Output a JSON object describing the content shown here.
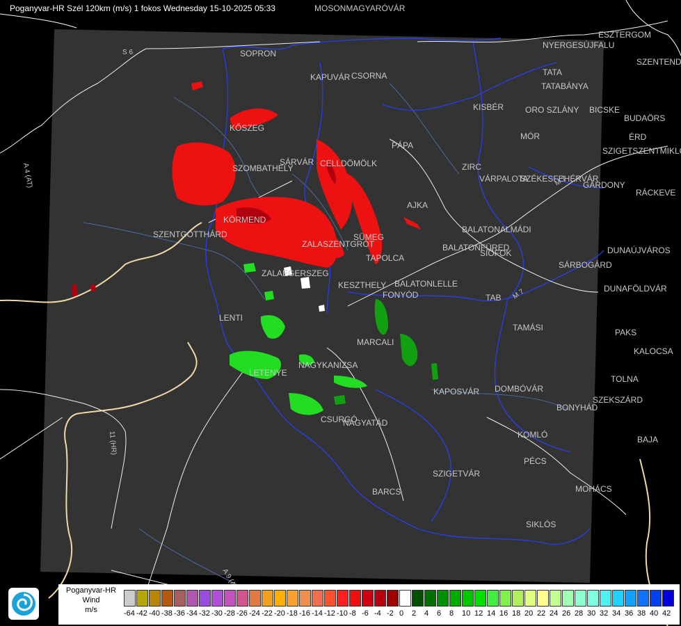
{
  "title": "Poganyvar-HR Szél 120km (m/s) 1 fokos Wednesday 15-10-2025 05:33",
  "cities": [
    "MOSONMAGYARÓVÁR",
    "SOPRON",
    "KAPUVÁR",
    "CSORNA",
    "KISBÉR",
    "TATA",
    "TATABÁNYA",
    "ESZTERGOM",
    "NYERGESÚJFALU",
    "SZENTENDRE",
    "ORO SZLÁNY",
    "BICSKE",
    "BUDAÖRS",
    "MÓR",
    "ÉRD",
    "SZIGETSZENTMIKLÓS",
    "KŐSZEG",
    "PÁPA",
    "SÁRVÁR",
    "CELLDÖMÖLK",
    "SZOMBATHELY",
    "ZIRC",
    "VÁRPALOTA",
    "SZÉKESFEHÉRVÁR",
    "GÁRDONY",
    "RÁCKEVE",
    "AJKA",
    "KÖRMEND",
    "SZENTGOTTHÁRD",
    "SÜMEG",
    "BALATONALMÁDI",
    "ZALASZENTGRÓT",
    "BALATONFÜRED",
    "SIÓFOK",
    "TAPOLCA",
    "DUNAÚJVÁROS",
    "SÁRBOGÁRD",
    "ZALAEGERSZEG",
    "KESZTHELY",
    "BALATONLELLE",
    "FONYÓD",
    "DUNAFÖLDVÁR",
    "TAB",
    "LENTI",
    "TAMÁSI",
    "PAKS",
    "MARCALI",
    "KALOCSA",
    "NAGYKANIZSA",
    "LETENYE",
    "TOLNA",
    "KAPOSVÁR",
    "DOMBÓVÁR",
    "SZEKSZÁRD",
    "BONYHÁD",
    "CSURGÓ",
    "NAGYATÁD",
    "KOMLÓ",
    "BAJA",
    "PÉCS",
    "SZIGETVÁR",
    "MOHÁCS",
    "BARCS",
    "SIKLÓS"
  ],
  "road_labels": [
    "S 6",
    "A 4 (AT)",
    "M 7",
    "M 7",
    "11 (HR)",
    "A 9 (AT)"
  ],
  "legend": {
    "label_lines": [
      "Poganyvar-HR",
      "Wind",
      "m/s"
    ],
    "ticks": [
      "-64",
      "-42",
      "-40",
      "-38",
      "-36",
      "-34",
      "-32",
      "-30",
      "-28",
      "-26",
      "-24",
      "-22",
      "-20",
      "-18",
      "-16",
      "-14",
      "-12",
      "-10",
      "-8",
      "-6",
      "-4",
      "-2",
      "0",
      "2",
      "4",
      "6",
      "8",
      "10",
      "12",
      "14",
      "16",
      "18",
      "20",
      "22",
      "24",
      "26",
      "28",
      "30",
      "32",
      "34",
      "36",
      "38",
      "40",
      "42"
    ],
    "colors": [
      "#cccccc",
      "#b5a60a",
      "#b88505",
      "#b45a10",
      "#a85f5f",
      "#b057b0",
      "#9a4ddd",
      "#b050d8",
      "#c053c0",
      "#d0558a",
      "#e07a40",
      "#f0a020",
      "#ffb000",
      "#f8a030",
      "#f09050",
      "#f07050",
      "#ff5030",
      "#ff2020",
      "#ee1010",
      "#d00010",
      "#b80010",
      "#a00000",
      "#ffffff",
      "#005000",
      "#007000",
      "#009000",
      "#00aa00",
      "#00c800",
      "#00e000",
      "#40f040",
      "#80f050",
      "#b0f060",
      "#e0ff80",
      "#ffff90",
      "#c0ff90",
      "#a0ffb0",
      "#90ffd0",
      "#80ffe0",
      "#50f0f0",
      "#20d0ff",
      "#10a0ff",
      "#1070ff",
      "#0040f0",
      "#0000dd"
    ]
  }
}
